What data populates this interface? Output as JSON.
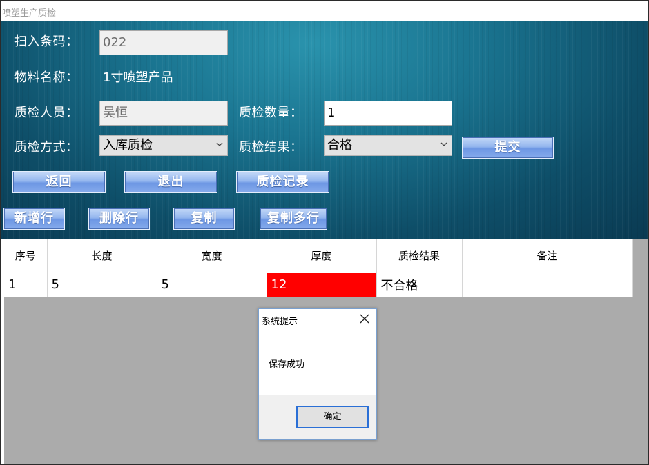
{
  "window": {
    "title": "喷塑生产质检"
  },
  "form": {
    "barcode_label": "扫入条码：",
    "barcode_value": "022",
    "material_label": "物料名称：",
    "material_value": "1寸喷塑产品",
    "inspector_label": "质检人员：",
    "inspector_value": "吴恒",
    "qty_label": "质检数量：",
    "qty_value": "1",
    "method_label": "质检方式：",
    "method_value": "入库质检",
    "result_label": "质检结果：",
    "result_value": "合格"
  },
  "buttons": {
    "submit": "提交",
    "back": "返回",
    "exit": "退出",
    "records": "质检记录",
    "add_row": "新增行",
    "delete_row": "删除行",
    "copy": "复制",
    "copy_multi": "复制多行"
  },
  "table": {
    "columns": [
      "序号",
      "长度",
      "宽度",
      "厚度",
      "质检结果",
      "备注"
    ],
    "rows": [
      [
        "1",
        "5",
        "5",
        "12",
        "不合格",
        ""
      ]
    ],
    "highlight_color": "#ff0000"
  },
  "dialog": {
    "title": "系统提示",
    "message": "保存成功",
    "ok_label": "确定"
  },
  "colors": {
    "panel_bg": "#1a7490",
    "button_bg": "#87abec",
    "error_cell": "#ff0000"
  }
}
